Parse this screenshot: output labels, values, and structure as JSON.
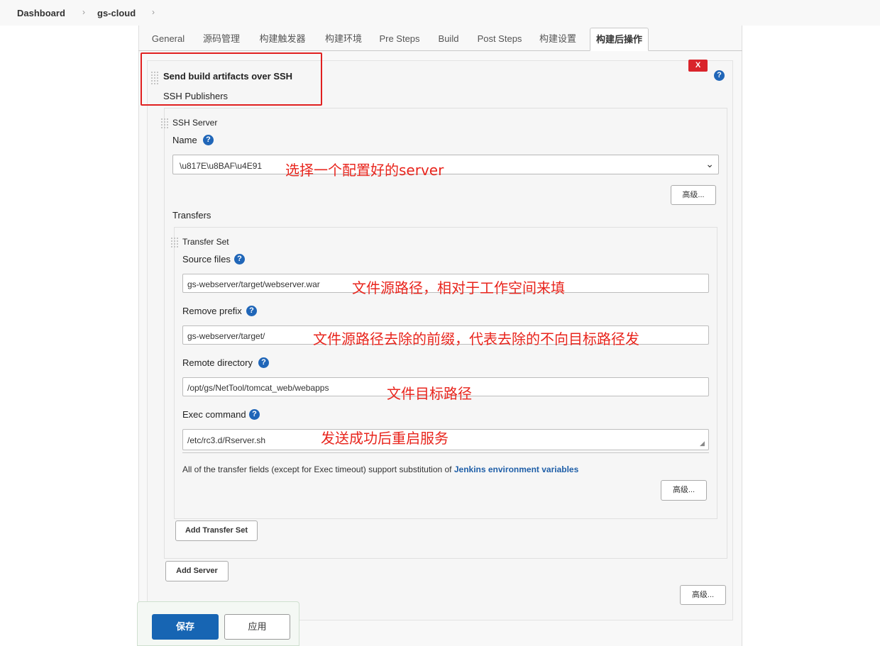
{
  "breadcrumb": {
    "items": [
      "Dashboard",
      "gs-cloud"
    ],
    "separator": "›"
  },
  "tabs": [
    "General",
    "源码管理",
    "构建触发器",
    "构建环境",
    "Pre Steps",
    "Build",
    "Post Steps",
    "构建设置",
    "构建后操作"
  ],
  "step": {
    "title": "Send build artifacts over SSH",
    "subtitle": "SSH Publishers",
    "delete_label": "X",
    "help_glyph": "?"
  },
  "ssh_server": {
    "section_label": "SSH Server",
    "name_label": "Name",
    "name_value": "\\u817E\\u8BAF\\u4E91",
    "advanced_label": "高级..."
  },
  "transfers": {
    "label": "Transfers",
    "set_label": "Transfer Set",
    "source_files_label": "Source files",
    "source_files_value": "gs-webserver/target/webserver.war",
    "remove_prefix_label": "Remove prefix",
    "remove_prefix_value": "gs-webserver/target/",
    "remote_directory_label": "Remote directory",
    "remote_directory_value": "/opt/gs/NetTool/tomcat_web/webapps",
    "exec_command_label": "Exec command",
    "exec_command_value": "/etc/rc3.d/Rserver.sh",
    "env_note_prefix": "All of the transfer fields (except for Exec timeout) support substitution of ",
    "env_note_link": "Jenkins environment variables",
    "advanced_label": "高级...",
    "add_transfer_set_label": "Add Transfer Set"
  },
  "add_server_label": "Add Server",
  "step_advanced_label": "高级...",
  "annotations": {
    "server": "选择一个配置好的server",
    "source": "文件源路径，相对于工作空间来填",
    "prefix": "文件源路径去除的前缀，代表去除的不向目标路径发",
    "remote": "文件目标路径",
    "exec": "发送成功后重启服务"
  },
  "footer": {
    "save_label": "保存",
    "apply_label": "应用"
  },
  "colors": {
    "save": "#1765b3",
    "annotation": "#e8251d",
    "delete": "#d9242b",
    "link": "#1f5fa8"
  }
}
